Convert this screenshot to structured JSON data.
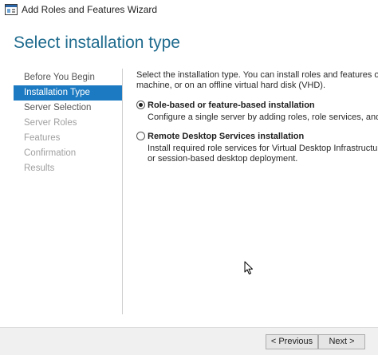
{
  "window": {
    "title": "Add Roles and Features Wizard",
    "app_icon": "server-manager-icon"
  },
  "header": {
    "title": "Select installation type"
  },
  "nav": {
    "items": [
      {
        "label": "Before You Begin",
        "state": "visited"
      },
      {
        "label": "Installation Type",
        "state": "selected"
      },
      {
        "label": "Server Selection",
        "state": "enabled"
      },
      {
        "label": "Server Roles",
        "state": "disabled"
      },
      {
        "label": "Features",
        "state": "disabled"
      },
      {
        "label": "Confirmation",
        "state": "disabled"
      },
      {
        "label": "Results",
        "state": "disabled"
      }
    ]
  },
  "content": {
    "intro_line1": "Select the installation type. You can install roles and features on a running physical computer or virtual",
    "intro_line2": "machine, or on an offline virtual hard disk (VHD).",
    "options": [
      {
        "label": "Role-based or feature-based installation",
        "description_line1": "Configure a single server by adding roles, role services, and features.",
        "description_line2": "",
        "checked": true
      },
      {
        "label": "Remote Desktop Services installation",
        "description_line1": "Install required role services for Virtual Desktop Infrastructure (VDI) to create a virtual machine-based",
        "description_line2": "or session-based desktop deployment.",
        "checked": false
      }
    ]
  },
  "footer": {
    "previous_label": "< Previous",
    "next_label": "Next >"
  },
  "colors": {
    "header_title": "#1f6b8e",
    "nav_selected_bg": "#1c7ac2",
    "nav_disabled": "#a0a0a0",
    "footer_bg": "#f0f0f0"
  }
}
